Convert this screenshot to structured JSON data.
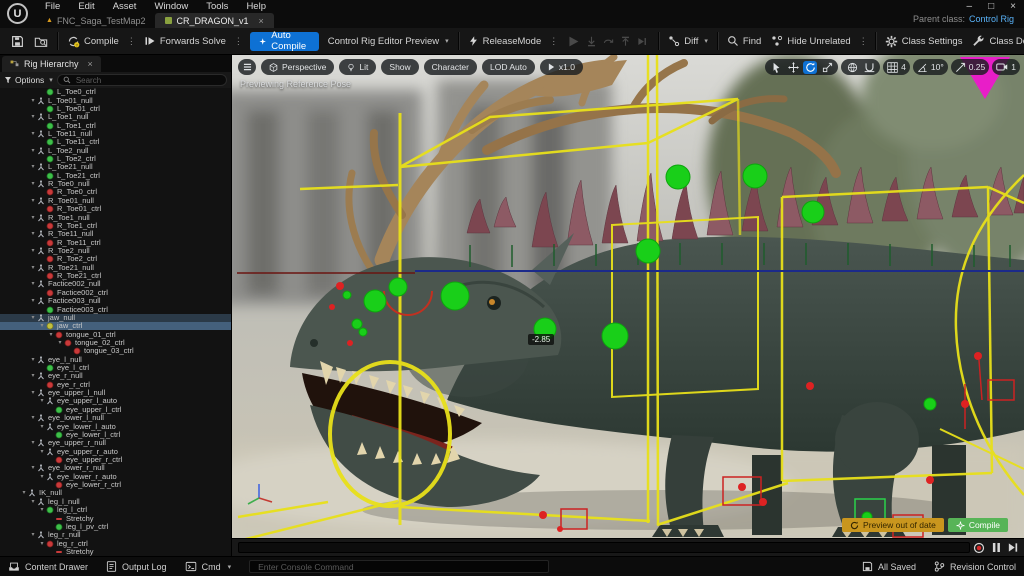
{
  "app": {
    "logo": "U"
  },
  "menu": {
    "items": [
      "File",
      "Edit",
      "Asset",
      "Window",
      "Tools",
      "Help"
    ]
  },
  "tabs": {
    "map_tab": "FNC_Saga_TestMap2",
    "rig_tab": "CR_DRAGON_v1",
    "close": "×"
  },
  "window_controls": {
    "minimize": "–",
    "maximize": "□",
    "close": "×"
  },
  "header": {
    "parent_class_label": "Parent class:",
    "parent_class_value": "Control Rig"
  },
  "toolbar": {
    "compile": "Compile",
    "forwards_solve": "Forwards Solve",
    "auto_compile": "Auto Compile",
    "preview_mode": "Control Rig Editor Preview",
    "release_mode": "ReleaseMode",
    "diff": "Diff",
    "find": "Find",
    "hide_unrelated": "Hide Unrelated",
    "class_settings": "Class Settings",
    "class_defaults": "Class Defaults"
  },
  "hierarchy": {
    "title": "Rig Hierarchy",
    "options_label": "Options",
    "search_placeholder": "Search",
    "items": [
      {
        "label": "L_Toe0_ctrl",
        "depth": 4,
        "icon": "ctrl-g"
      },
      {
        "label": "L_Toe01_null",
        "depth": 3,
        "icon": "null"
      },
      {
        "label": "L_Toe01_ctrl",
        "depth": 4,
        "icon": "ctrl-g"
      },
      {
        "label": "L_Toe1_null",
        "depth": 3,
        "icon": "null"
      },
      {
        "label": "L_Toe1_ctrl",
        "depth": 4,
        "icon": "ctrl-g"
      },
      {
        "label": "L_Toe11_null",
        "depth": 3,
        "icon": "null"
      },
      {
        "label": "L_Toe11_ctrl",
        "depth": 4,
        "icon": "ctrl-g"
      },
      {
        "label": "L_Toe2_null",
        "depth": 3,
        "icon": "null"
      },
      {
        "label": "L_Toe2_ctrl",
        "depth": 4,
        "icon": "ctrl-g"
      },
      {
        "label": "L_Toe21_null",
        "depth": 3,
        "icon": "null"
      },
      {
        "label": "L_Toe21_ctrl",
        "depth": 4,
        "icon": "ctrl-g"
      },
      {
        "label": "R_Toe0_null",
        "depth": 3,
        "icon": "null"
      },
      {
        "label": "R_Toe0_ctrl",
        "depth": 4,
        "icon": "ctrl-r"
      },
      {
        "label": "R_Toe01_null",
        "depth": 3,
        "icon": "null"
      },
      {
        "label": "R_Toe01_ctrl",
        "depth": 4,
        "icon": "ctrl-r"
      },
      {
        "label": "R_Toe1_null",
        "depth": 3,
        "icon": "null"
      },
      {
        "label": "R_Toe1_ctrl",
        "depth": 4,
        "icon": "ctrl-r"
      },
      {
        "label": "R_Toe11_null",
        "depth": 3,
        "icon": "null"
      },
      {
        "label": "R_Toe11_ctrl",
        "depth": 4,
        "icon": "ctrl-r"
      },
      {
        "label": "R_Toe2_null",
        "depth": 3,
        "icon": "null"
      },
      {
        "label": "R_Toe2_ctrl",
        "depth": 4,
        "icon": "ctrl-r"
      },
      {
        "label": "R_Toe21_null",
        "depth": 3,
        "icon": "null"
      },
      {
        "label": "R_Toe21_ctrl",
        "depth": 4,
        "icon": "ctrl-r"
      },
      {
        "label": "Factice002_null",
        "depth": 3,
        "icon": "null"
      },
      {
        "label": "Factice002_ctrl",
        "depth": 4,
        "icon": "ctrl-r"
      },
      {
        "label": "Factice003_null",
        "depth": 3,
        "icon": "null"
      },
      {
        "label": "Factice003_ctrl",
        "depth": 4,
        "icon": "ctrl-g"
      },
      {
        "label": "jaw_null",
        "depth": 3,
        "icon": "null",
        "state": "dim"
      },
      {
        "label": "jaw_ctrl",
        "depth": 4,
        "icon": "ctrl-y",
        "state": "sel"
      },
      {
        "label": "tongue_01_ctrl",
        "depth": 5,
        "icon": "ctrl-r"
      },
      {
        "label": "tongue_02_ctrl",
        "depth": 6,
        "icon": "ctrl-r"
      },
      {
        "label": "tongue_03_ctrl",
        "depth": 7,
        "icon": "ctrl-r"
      },
      {
        "label": "eye_l_null",
        "depth": 3,
        "icon": "null"
      },
      {
        "label": "eye_l_ctrl",
        "depth": 4,
        "icon": "ctrl-g"
      },
      {
        "label": "eye_r_null",
        "depth": 3,
        "icon": "null"
      },
      {
        "label": "eye_r_ctrl",
        "depth": 4,
        "icon": "ctrl-r"
      },
      {
        "label": "eye_upper_l_null",
        "depth": 3,
        "icon": "null"
      },
      {
        "label": "eye_upper_l_auto",
        "depth": 4,
        "icon": "null"
      },
      {
        "label": "eye_upper_l_ctrl",
        "depth": 5,
        "icon": "ctrl-g"
      },
      {
        "label": "eye_lower_l_null",
        "depth": 3,
        "icon": "null"
      },
      {
        "label": "eye_lower_l_auto",
        "depth": 4,
        "icon": "null"
      },
      {
        "label": "eye_lower_l_ctrl",
        "depth": 5,
        "icon": "ctrl-g"
      },
      {
        "label": "eye_upper_r_null",
        "depth": 3,
        "icon": "null"
      },
      {
        "label": "eye_upper_r_auto",
        "depth": 4,
        "icon": "null"
      },
      {
        "label": "eye_upper_r_ctrl",
        "depth": 5,
        "icon": "ctrl-r"
      },
      {
        "label": "eye_lower_r_null",
        "depth": 3,
        "icon": "null"
      },
      {
        "label": "eye_lower_r_auto",
        "depth": 4,
        "icon": "null"
      },
      {
        "label": "eye_lower_r_ctrl",
        "depth": 5,
        "icon": "ctrl-r"
      },
      {
        "label": "IK_null",
        "depth": 2,
        "icon": "null"
      },
      {
        "label": "leg_l_null",
        "depth": 3,
        "icon": "null"
      },
      {
        "label": "leg_l_ctrl",
        "depth": 4,
        "icon": "ctrl-g"
      },
      {
        "label": "Stretchy",
        "depth": 5,
        "icon": "dash"
      },
      {
        "label": "leg_l_pv_ctrl",
        "depth": 5,
        "icon": "ctrl-g"
      },
      {
        "label": "leg_r_null",
        "depth": 3,
        "icon": "null"
      },
      {
        "label": "leg_r_ctrl",
        "depth": 4,
        "icon": "ctrl-r"
      },
      {
        "label": "Stretchy",
        "depth": 5,
        "icon": "dash"
      }
    ]
  },
  "viewport": {
    "pills": {
      "perspective": "Perspective",
      "lit": "Lit",
      "show": "Show",
      "character": "Character",
      "lod": "LOD Auto",
      "speed": "x1.0"
    },
    "status_text": "Previewing Reference Pose",
    "snap_grid": "4",
    "snap_angle": "10°",
    "snap_scale": "0.25",
    "camera_speed": "1",
    "value_badge": "-2.85",
    "preview_warning": "Preview out of date",
    "compile_button": "Compile"
  },
  "statusbar": {
    "content_drawer": "Content Drawer",
    "output_log": "Output Log",
    "cmd": "Cmd",
    "console_placeholder": "Enter Console Command",
    "all_saved": "All Saved",
    "revision_control": "Revision Control"
  },
  "colors": {
    "accent_blue": "#0e71d4",
    "selection": "#44607c",
    "wireframe_yellow": "#e8e01a",
    "control_green": "#19cf19",
    "control_red": "#dd2222",
    "magenta_pin": "#e81ec8",
    "warning_yellow": "#c9961e",
    "compile_green": "#57b457",
    "link_blue": "#59b2f8"
  }
}
